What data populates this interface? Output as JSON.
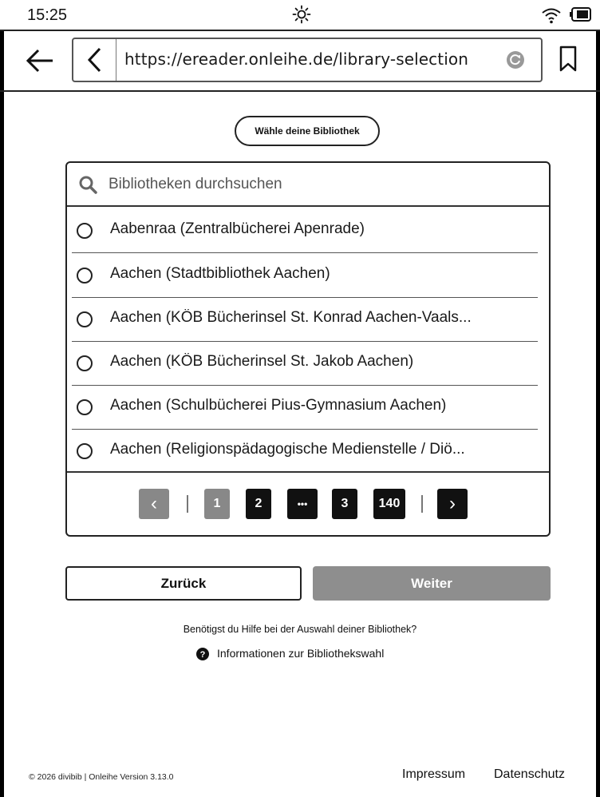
{
  "status": {
    "time": "15:25",
    "icons": [
      "brightness-icon",
      "wifi-icon",
      "battery-icon"
    ]
  },
  "browser": {
    "url": "https://ereader.onleihe.de/library-selection",
    "icons": [
      "back-arrow-icon",
      "chevron-left-icon",
      "reload-icon",
      "bookmark-icon"
    ]
  },
  "chooser": {
    "title": "Wähle deine Bibliothek",
    "search_placeholder": "Bibliotheken durchsuchen",
    "libraries": [
      {
        "label": "Aabenraa (Zentralbücherei Apenrade)",
        "selected": false
      },
      {
        "label": "Aachen (Stadtbibliothek Aachen)",
        "selected": false
      },
      {
        "label": "Aachen (KÖB Bücherinsel St. Konrad Aachen-Vaals...",
        "selected": false
      },
      {
        "label": "Aachen (KÖB Bücherinsel St. Jakob Aachen)",
        "selected": false
      },
      {
        "label": "Aachen (Schulbücherei Pius-Gymnasium Aachen)",
        "selected": false
      },
      {
        "label": "Aachen (Religionspädagogische Medienstelle / Diö...",
        "selected": false
      }
    ],
    "pagination": {
      "prev": "‹",
      "next": "›",
      "pages": [
        "1",
        "2",
        "•••",
        "3",
        "140"
      ],
      "current": "1"
    }
  },
  "actions": {
    "back_label": "Zurück",
    "next_label": "Weiter"
  },
  "help": {
    "question": "Benötigst du Hilfe bei der Auswahl deiner Bibliothek?",
    "link": "Informationen zur Bibliothekswahl"
  },
  "footer": {
    "copyright": "© 2026 divibib | Onleihe Version 3.13.0",
    "impressum": "Impressum",
    "datenschutz": "Datenschutz"
  }
}
